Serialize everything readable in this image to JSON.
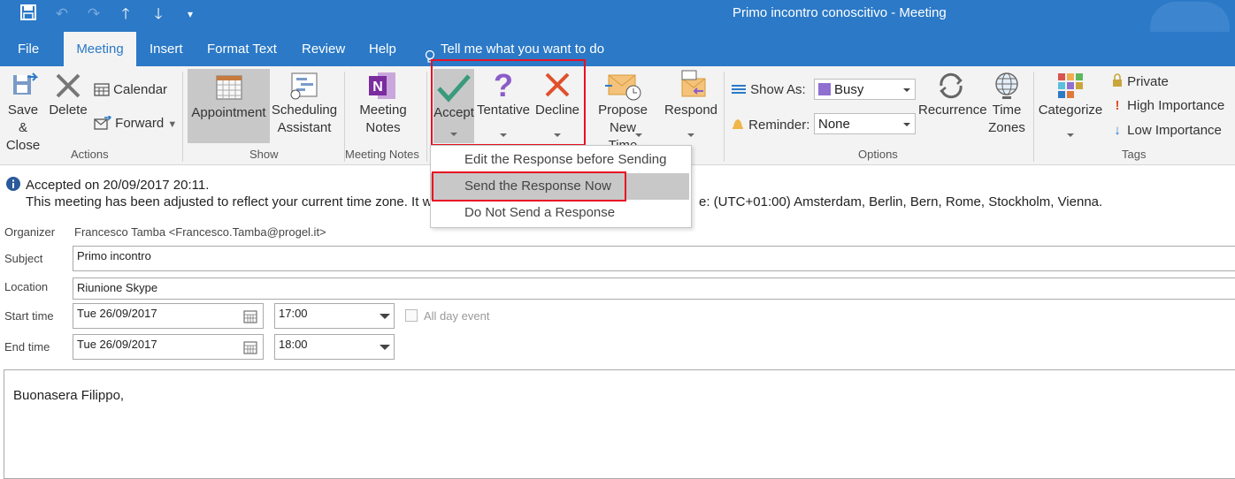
{
  "window": {
    "title": "Primo incontro conoscitivo  -  Meeting"
  },
  "tabs": [
    "File",
    "Meeting",
    "Insert",
    "Format Text",
    "Review",
    "Help"
  ],
  "tell_me": "Tell me what you want to do",
  "ribbon": {
    "actions": {
      "group_label": "Actions",
      "save_close": [
        "Save &",
        "Close"
      ],
      "delete": "Delete",
      "calendar": "Calendar",
      "forward": "Forward"
    },
    "show": {
      "group_label": "Show",
      "appointment": "Appointment",
      "scheduling": [
        "Scheduling",
        "Assistant"
      ]
    },
    "meeting_notes": {
      "group_label": "Meeting Notes",
      "label": [
        "Meeting",
        "Notes"
      ]
    },
    "respond": {
      "accept": "Accept",
      "tentative": "Tentative",
      "decline": "Decline",
      "propose": [
        "Propose New",
        "Time"
      ],
      "respond": "Respond"
    },
    "options": {
      "group_label": "Options",
      "show_as_label": "Show As:",
      "show_as_value": "Busy",
      "reminder_label": "Reminder:",
      "reminder_value": "None",
      "recurrence": "Recurrence",
      "time_zones": [
        "Time",
        "Zones"
      ]
    },
    "tags": {
      "group_label": "Tags",
      "categorize": "Categorize",
      "private": "Private",
      "high": "High Importance",
      "low": "Low Importance"
    }
  },
  "accept_menu": {
    "items": [
      "Edit the Response before Sending",
      "Send the Response Now",
      "Do Not Send a Response"
    ]
  },
  "info": {
    "line1": "Accepted on 20/09/2017 20:11.",
    "line2_start": "This meeting has been adjusted to reflect your current time zone. It w",
    "line2_end": "e: (UTC+01:00) Amsterdam, Berlin, Bern, Rome, Stockholm, Vienna."
  },
  "form": {
    "organizer_label": "Organizer",
    "organizer_value": "Francesco Tamba <Francesco.Tamba@progel.it>",
    "subject_label": "Subject",
    "subject_value": "Primo incontro",
    "location_label": "Location",
    "location_value": "Riunione Skype",
    "start_label": "Start time",
    "start_date": "Tue 26/09/2017",
    "start_time": "17:00",
    "all_day": "All day event",
    "end_label": "End time",
    "end_date": "Tue 26/09/2017",
    "end_time": "18:00"
  },
  "body_text": "Buonasera Filippo,",
  "colors": {
    "accent": "#2b79c7",
    "highlight_box": "#e81123",
    "ribbon_bg": "#f3f3f3"
  }
}
